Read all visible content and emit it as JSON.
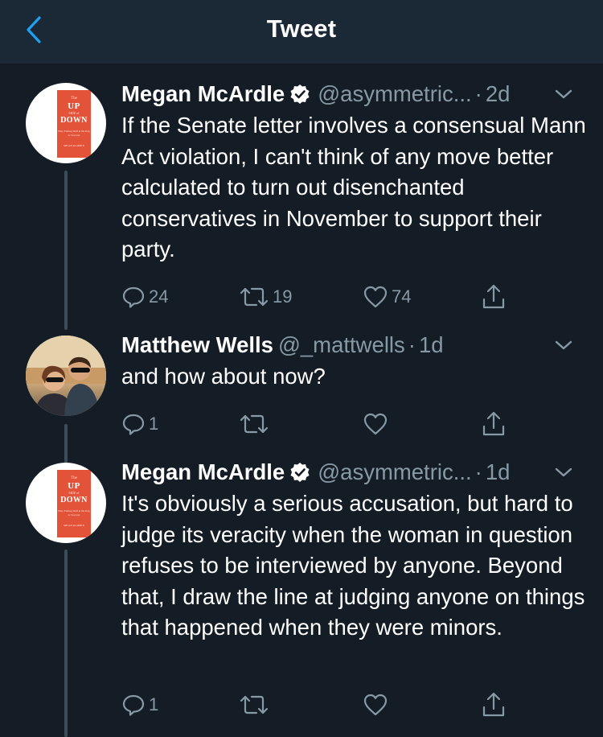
{
  "header": {
    "title": "Tweet",
    "back_icon": "chevron-left-icon"
  },
  "colors": {
    "accent": "#1da1f2",
    "muted": "#8899a6",
    "background": "#141d26",
    "header": "#1b2836"
  },
  "tweets": [
    {
      "name": "Megan McArdle",
      "verified": true,
      "handle": "@asymmetric...",
      "time": "2d",
      "text": "If the Senate letter involves a consensual Mann Act violation, I can't think of any move better calculated to turn out disenchanted conservatives in November to support their party.",
      "reply_count": "24",
      "retweet_count": "19",
      "like_count": "74",
      "avatar_book": {
        "t1": "The",
        "t2": "UP",
        "t3": "SIDE of",
        "t4": "DOWN",
        "t5": "Why Failing Well is the Key to Success",
        "t6": "MEGAN McARDLE"
      }
    },
    {
      "name": "Matthew Wells",
      "verified": false,
      "handle": "@_mattwells",
      "time": "1d",
      "text": "and how about now?",
      "reply_count": "1",
      "retweet_count": "",
      "like_count": ""
    },
    {
      "name": "Megan McArdle",
      "verified": true,
      "handle": "@asymmetric...",
      "time": "1d",
      "text": "It's obviously a serious accusation, but hard to judge its veracity when the woman in question refuses to be interviewed by anyone.  Beyond that, I draw the line at judging anyone on things that happened when they were minors.",
      "reply_count": "1",
      "retweet_count": "",
      "like_count": "",
      "avatar_book": {
        "t1": "The",
        "t2": "UP",
        "t3": "SIDE of",
        "t4": "DOWN",
        "t5": "Why Failing Well is the Key to Success",
        "t6": "MEGAN McARDLE"
      }
    }
  ]
}
